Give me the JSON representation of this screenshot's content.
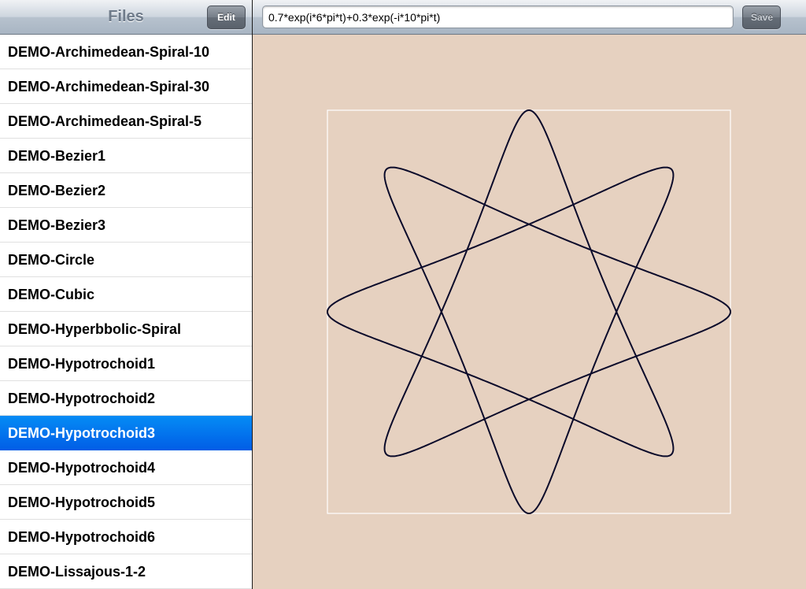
{
  "master": {
    "title": "Files",
    "edit_label": "Edit",
    "files": [
      "DEMO-Archimedean-Spiral-10",
      "DEMO-Archimedean-Spiral-30",
      "DEMO-Archimedean-Spiral-5",
      "DEMO-Bezier1",
      "DEMO-Bezier2",
      "DEMO-Bezier3",
      "DEMO-Circle",
      "DEMO-Cubic",
      "DEMO-Hyperbbolic-Spiral",
      "DEMO-Hypotrochoid1",
      "DEMO-Hypotrochoid2",
      "DEMO-Hypotrochoid3",
      "DEMO-Hypotrochoid4",
      "DEMO-Hypotrochoid5",
      "DEMO-Hypotrochoid6",
      "DEMO-Lissajous-1-2"
    ],
    "selected_index": 11
  },
  "detail": {
    "formula": "0.7*exp(i*6*pi*t)+0.3*exp(-i*10*pi*t)",
    "save_label": "Save"
  },
  "colors": {
    "canvas_bg": "#e6d1c0",
    "curve": "#0a0a2a",
    "frame": "#ffffff",
    "selection": "#0a6ff0"
  },
  "plot": {
    "a": 0.7,
    "m": 6,
    "b": 0.3,
    "n": -10,
    "t_range": [
      0,
      1
    ]
  }
}
